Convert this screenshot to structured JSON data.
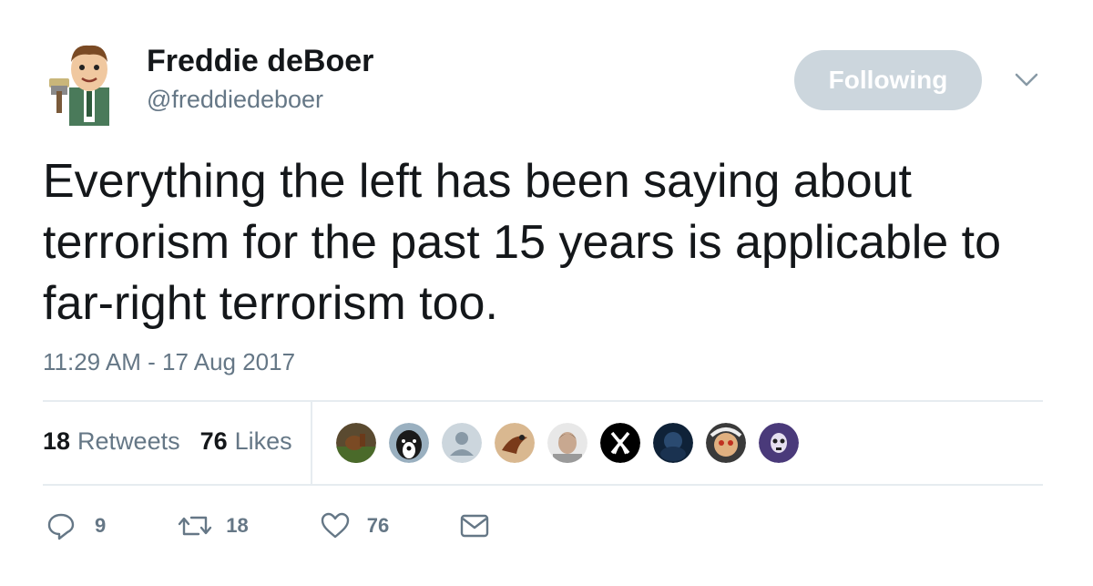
{
  "author": {
    "name": "Freddie deBoer",
    "handle": "@freddiedeboer"
  },
  "follow_button_label": "Following",
  "tweet": {
    "text": "Everything the left has been saying about terrorism for the past 15 years is applicable to far-right terrorism too.",
    "timestamp": "11:29 AM - 17 Aug 2017"
  },
  "stats": {
    "retweets_count": "18",
    "retweets_label": "Retweets",
    "likes_count": "76",
    "likes_label": "Likes"
  },
  "liker_avatars": [
    {
      "icon": "horse-photo-avatar",
      "color": "#6b4a2c"
    },
    {
      "icon": "dog-photo-avatar",
      "color": "#2b2b2b"
    },
    {
      "icon": "default-person-avatar",
      "color": "#ccd6dd"
    },
    {
      "icon": "bird-art-avatar",
      "color": "#b07a4a"
    },
    {
      "icon": "man-portrait-avatar",
      "color": "#cfcfcf"
    },
    {
      "icon": "letter-x-avatar",
      "color": "#000000"
    },
    {
      "icon": "dark-blue-avatar",
      "color": "#1b3550"
    },
    {
      "icon": "cartoon-face-avatar",
      "color": "#c9a070"
    },
    {
      "icon": "skull-purple-avatar",
      "color": "#3a2a5e"
    }
  ],
  "actions": {
    "replies": "9",
    "retweets": "18",
    "likes": "76"
  },
  "colors": {
    "text": "#14171a",
    "muted": "#657786",
    "button_bg": "#ccd6dd",
    "divider": "#e6ecf0"
  }
}
